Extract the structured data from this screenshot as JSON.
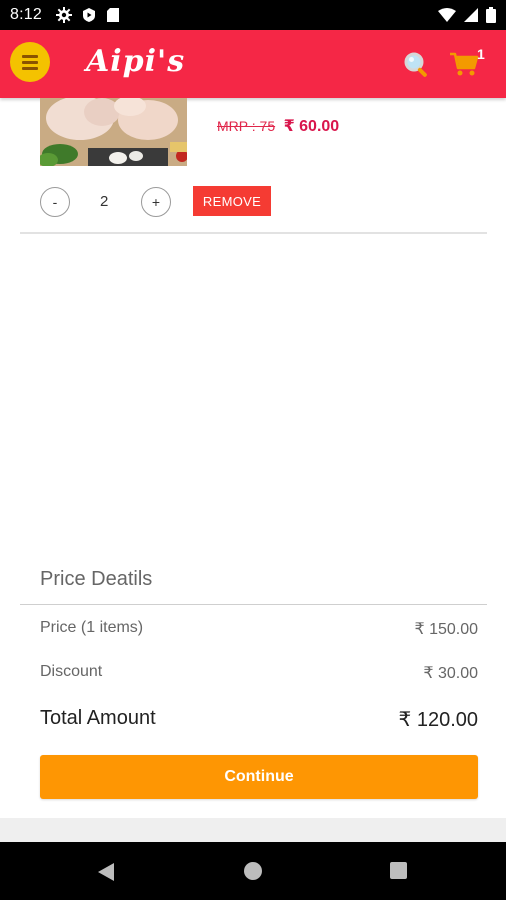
{
  "status_bar": {
    "time": "8:12"
  },
  "app_bar": {
    "logo_text": "Aipi's",
    "cart_count": "1"
  },
  "cart_item": {
    "mrp": "MRP : 75",
    "price": "₹ 60.00",
    "quantity": "2",
    "minus_label": "-",
    "plus_label": "+",
    "remove_label": "REMOVE"
  },
  "price_details": {
    "title": "Price Deatils",
    "rows": [
      {
        "label": "Price (1 items)",
        "value": "₹ 150.00"
      },
      {
        "label": "Discount",
        "value": "₹ 30.00"
      }
    ],
    "total_label": "Total Amount",
    "total_value": "₹ 120.00",
    "continue_label": "Continue"
  },
  "colors": {
    "app_bar": "#f52746",
    "menu_button": "#f4c200",
    "remove_button": "#f53b33",
    "continue_button": "#fe9603",
    "price_accent": "#d9164c"
  }
}
